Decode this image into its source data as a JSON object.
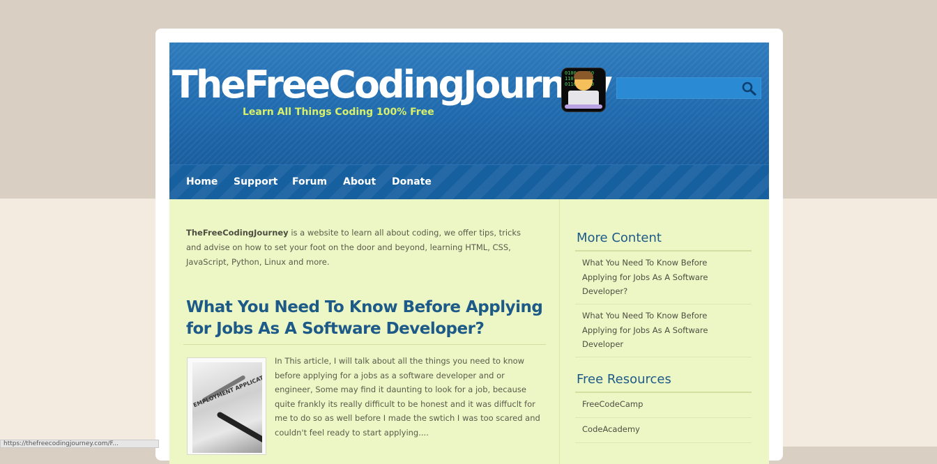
{
  "site": {
    "title": "TheFreeCodingJourney",
    "tagline": "Learn All Things Coding 100% Free",
    "logo_icon": "coder-laptop-icon",
    "logo_binary": "0100  1010\n1101  0011\n0110  1100"
  },
  "search": {
    "value": "",
    "placeholder": "",
    "button_icon": "search-icon"
  },
  "nav": {
    "items": [
      {
        "label": "Home"
      },
      {
        "label": "Support"
      },
      {
        "label": "Forum"
      },
      {
        "label": "About"
      },
      {
        "label": "Donate"
      }
    ]
  },
  "intro": {
    "site_name": "TheFreeCodingJourney",
    "text": " is a website to learn all about coding, we offer tips, tricks and advise on how to set your foot on the door and beyond, learning HTML, CSS, JavaScript, Python, Linux and more."
  },
  "post": {
    "title": "What You Need To Know Before Applying for Jobs As A Software Developer?",
    "thumbnail_caption": "EMPLOYMENT APPLICATION",
    "excerpt": "In This article, I will talk about all the things you need to know before applying for a jobs as a software developer and or engineer, Some may find it daunting to look for a job, because quite frankly its really difficult to be honest and it was diffuclt for me to do so as well before I made the swtich I was too scared and couldn't feel ready to start applying...."
  },
  "sidebar": {
    "more_content": {
      "heading": "More Content",
      "links": [
        {
          "label": "What You Need To Know Before Applying for Jobs As A Software Developer?"
        },
        {
          "label": "What You Need To Know Before Applying for Jobs As A Software Developer"
        }
      ]
    },
    "free_resources": {
      "heading": "Free Resources",
      "links": [
        {
          "label": "FreeCodeCamp"
        },
        {
          "label": "CodeAcademy"
        }
      ]
    }
  },
  "status_bar": {
    "text": "https://thefreecodingjourney.com/F..."
  },
  "colors": {
    "header_blue": "#1f69ad",
    "nav_blue": "#1760a0",
    "content_bg": "#edf7c6",
    "title_blue": "#1d5a88",
    "tagline_green": "#d8f06a"
  }
}
